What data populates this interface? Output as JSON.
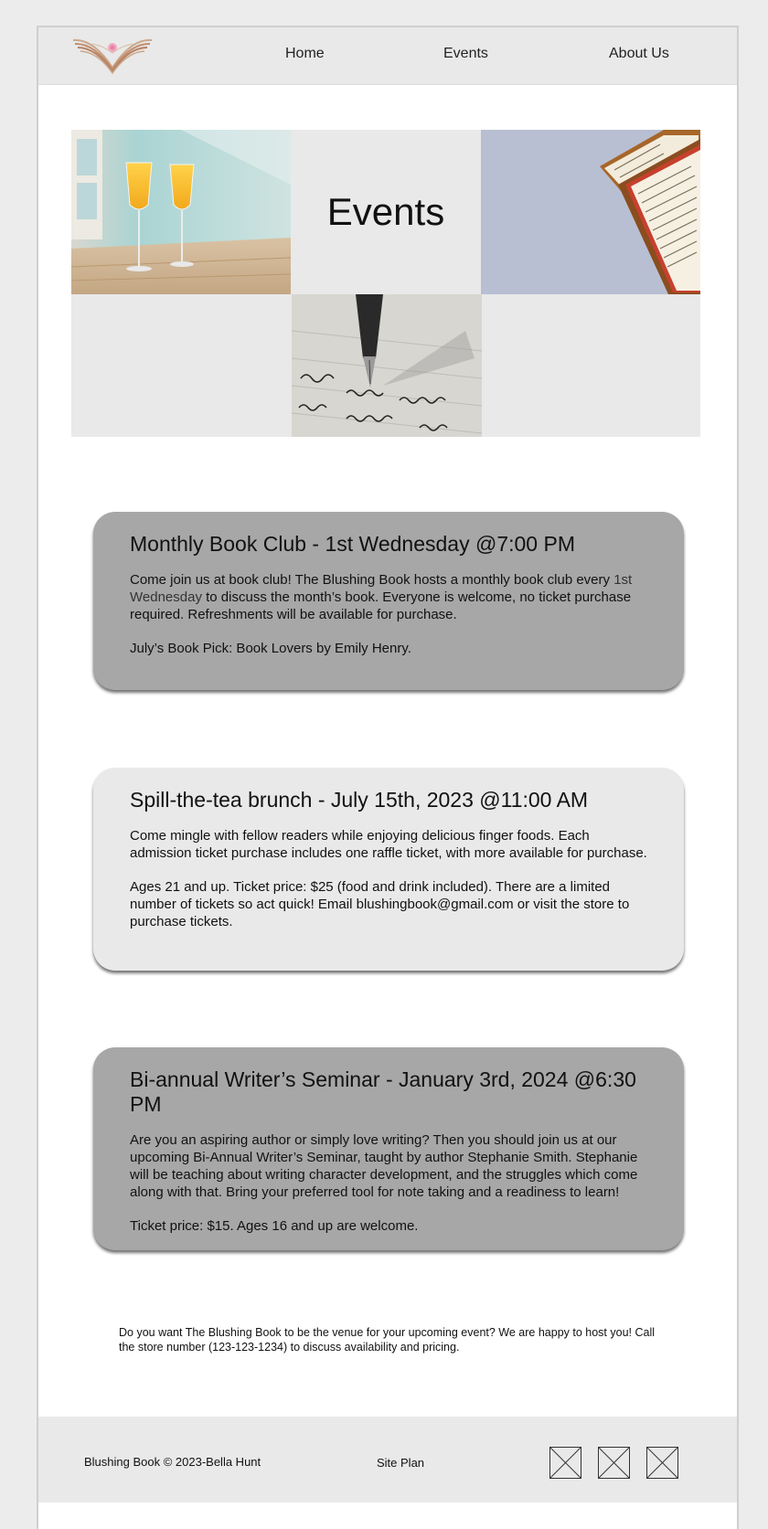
{
  "header": {
    "logo": "open-book-logo",
    "nav": [
      {
        "label": "Home"
      },
      {
        "label": "Events"
      },
      {
        "label": "About Us"
      }
    ]
  },
  "hero": {
    "title": "Events",
    "images": [
      "mimosa-glasses-photo",
      "open-books-photo",
      "fountain-pen-writing-photo"
    ]
  },
  "events": [
    {
      "title": "Monthly Book Club - 1st Wednesday @7:00 PM",
      "p1_before": "Come join us at book club! The Blushing Book hosts a monthly book club every ",
      "p1_accent": "1st Wednesday",
      "p1_after": "  to discuss the month’s book. Everyone is welcome, no ticket purchase required. Refreshments will be available for purchase.",
      "p2": "July’s Book Pick: Book Lovers by Emily Henry."
    },
    {
      "title": "Spill-the-tea brunch - July 15th, 2023 @11:00 AM",
      "p1": "Come mingle with fellow readers while enjoying delicious finger foods. Each admission ticket purchase includes one raffle ticket, with more available for purchase.",
      "p2": "Ages 21 and up. Ticket price: $25 (food and drink included). There are a limited number of tickets so act quick! Email blushingbook@gmail.com or visit the store to purchase tickets."
    },
    {
      "title": "Bi-annual Writer’s Seminar - January 3rd, 2024 @6:30 PM",
      "p1": "Are you an aspiring author or simply love writing? Then you should join us at our upcoming Bi-Annual Writer’s Seminar, taught by author Stephanie Smith. Stephanie will be teaching about writing character development, and the struggles which come along with that. Bring your preferred tool for note taking and a readiness to learn!",
      "p2": "Ticket price: $15. Ages 16 and up are welcome."
    }
  ],
  "host_note": "Do you want The Blushing Book to be the venue for your upcoming event? We are happy to host you! Call the store number (123-123-1234) to discuss availability and pricing.",
  "footer": {
    "copyright": "Blushing Book © 2023-Bella Hunt",
    "site_plan": "Site Plan",
    "social_icons": [
      "social-placeholder-icon",
      "social-placeholder-icon",
      "social-placeholder-icon"
    ]
  }
}
